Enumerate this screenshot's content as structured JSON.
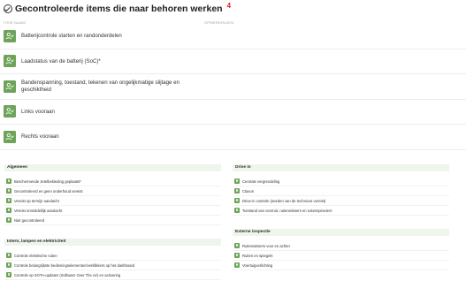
{
  "header": {
    "title": "Gecontroleerde items die naar behoren werken",
    "count": "4",
    "col_name": "ITEM NAAM",
    "col_remarks": "OPMERKINGEN"
  },
  "items": [
    {
      "label": "Batterijcontrole starten en randonderdelen"
    },
    {
      "label": "Laadstatus van de batterij (SoC)*"
    },
    {
      "label": "Bandenspanning, toestand, tekenen van ongelijkmatige slijtage en geschiktheid"
    },
    {
      "label": "Links vooraan"
    },
    {
      "label": "Rechts vooraan"
    }
  ],
  "sections": {
    "algemeen": {
      "title": "Algemeen",
      "rows": [
        "Beschermende zetelbekleding geplaatst*",
        "Gecontroleerd en geen onderhoud vereist",
        "Vereist op termijn aandacht",
        "Vereist onmiddellijk aandacht",
        "Niet gecontroleerd"
      ]
    },
    "drive_in": {
      "title": "Drive in",
      "rows": [
        "Centrale vergrendeling",
        "Claxon",
        "Drive-in controle (worden van de technicus vereist)",
        "Toestand van voorruit, ruitenwissers en ruitensproeiers"
      ]
    },
    "intern": {
      "title": "Intern, lampen en elektriciteit",
      "rows": [
        "Controle elektrische ruiten",
        "Controle belangrijkste bedieningselementen/verklikkers op het dashboard",
        "Controle op SOTA-updates (Software Over The Air) en activering"
      ]
    },
    "extern": {
      "title": "Externe inspectie",
      "rows": [
        "Ruitenwissers voor en achter",
        "Ruiten en spiegels",
        "Voertuigverlichting"
      ]
    }
  },
  "colors": {
    "accent_green": "#6fa35a",
    "section_bg": "#eef5ea",
    "count_red": "#e02020"
  }
}
